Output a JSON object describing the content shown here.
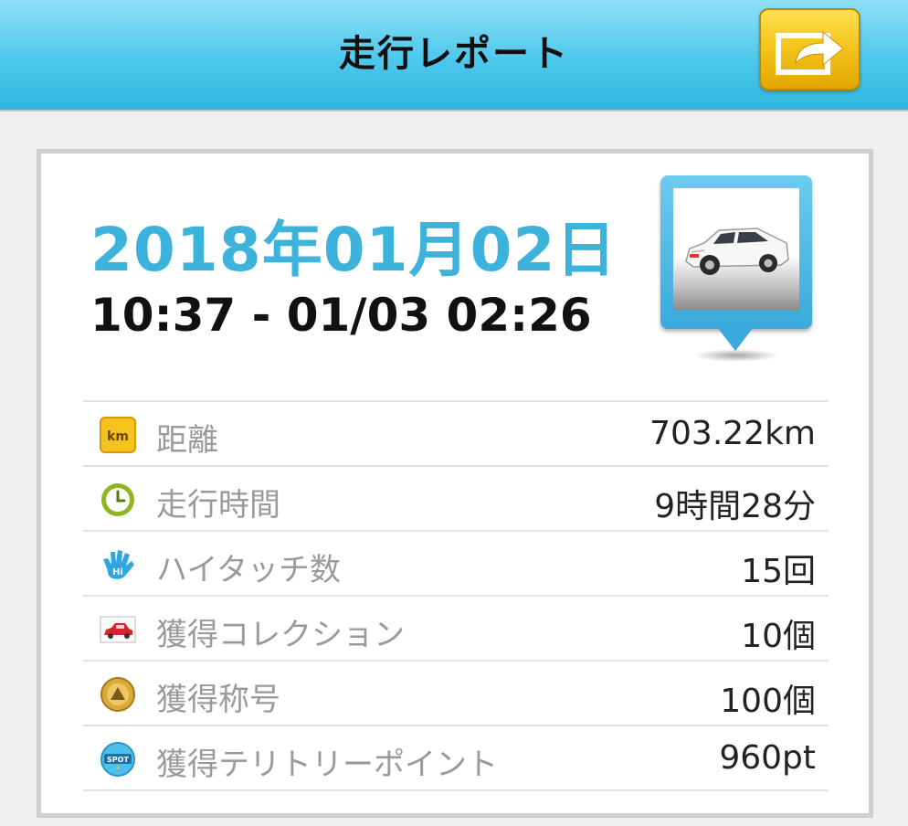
{
  "header": {
    "title": "走行レポート",
    "share_icon": "share-arrow-icon",
    "accent": "#3db3dc"
  },
  "report": {
    "date": "2018年01月02日",
    "time_range": "10:37 - 01/03 02:26",
    "vehicle_image": "white-suv-car"
  },
  "stats": [
    {
      "icon": "km-icon",
      "label": "距離",
      "value": "703.22km"
    },
    {
      "icon": "clock-icon",
      "label": "走行時間",
      "value": "9時間28分"
    },
    {
      "icon": "hi-hand-icon",
      "label": "ハイタッチ数",
      "value": "15回"
    },
    {
      "icon": "red-car-icon",
      "label": "獲得コレクション",
      "value": "10個"
    },
    {
      "icon": "medal-icon",
      "label": "獲得称号",
      "value": "100個"
    },
    {
      "icon": "spot-icon",
      "label": "獲得テリトリーポイント",
      "value": "960pt"
    }
  ],
  "icon_text": {
    "km": "km",
    "hi": "Hi",
    "spot": "SPOT"
  }
}
